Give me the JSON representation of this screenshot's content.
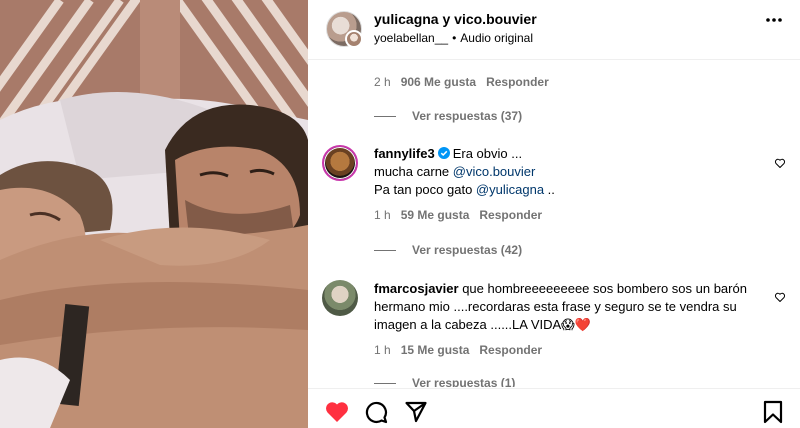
{
  "header": {
    "user_a": "yulicagna",
    "connector": "y",
    "user_b": "vico.bouvier",
    "audio_user": "yoelabellan__",
    "separator": "•",
    "audio_label": "Audio original",
    "more_icon": "more-horizontal-icon"
  },
  "comments": {
    "top_partial": {
      "time": "2 h",
      "likes": "906 Me gusta",
      "reply": "Responder",
      "view_replies": "Ver respuestas (37)"
    },
    "items": [
      {
        "user": "fannylife3",
        "verified": true,
        "line1": "Era obvio ...",
        "line2_pre": "mucha carne ",
        "line2_mention": "@vico.bouvier",
        "line3_pre": "Pa tan poco gato ",
        "line3_mention": "@yulicagna",
        "line3_post": " ..",
        "time": "1 h",
        "likes": "59 Me gusta",
        "reply": "Responder",
        "view_replies": "Ver respuestas (42)"
      },
      {
        "user": "fmarcosjavier",
        "text": "que hombreeeeeeeee sos bombero sos un barón hermano mio ....recordaras esta frase y seguro se te vendra su imagen a la cabeza ......LA VIDA",
        "emoji1": "😱",
        "emoji2": "❤️",
        "time": "1 h",
        "likes": "15 Me gusta",
        "reply": "Responder",
        "view_replies": "Ver respuestas (1)"
      }
    ]
  },
  "actions": {
    "like_icon": "heart-filled-icon",
    "comment_icon": "comment-icon",
    "share_icon": "share-icon",
    "save_icon": "bookmark-icon",
    "like_color": "#ff3040"
  }
}
